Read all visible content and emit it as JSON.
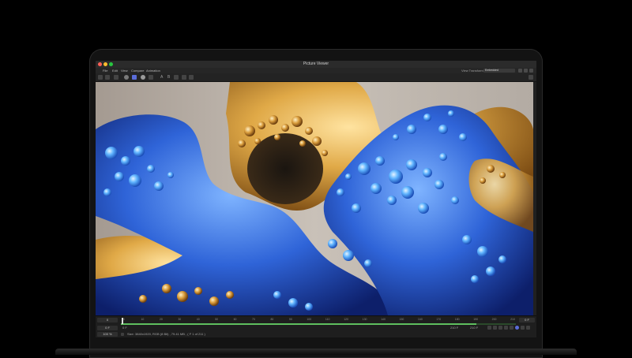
{
  "window": {
    "title": "Picture Viewer"
  },
  "menu": {
    "items": [
      "File",
      "Edit",
      "View",
      "Compare",
      "Animation"
    ],
    "view_transform_label": "View Transform:",
    "view_transform_value": "Embedded"
  },
  "toolbar": {
    "text_a": "A",
    "text_b": "B"
  },
  "timeline": {
    "current_frame": "0",
    "end_frame": "0 F",
    "ticks": [
      "0",
      "10",
      "20",
      "30",
      "40",
      "50",
      "60",
      "70",
      "80",
      "90",
      "100",
      "110",
      "120",
      "130",
      "140",
      "150",
      "160",
      "170",
      "180",
      "190",
      "200",
      "210"
    ],
    "progress": 0.9
  },
  "controls": {
    "left_value": "0 F",
    "start_value": "0 F",
    "range_start": "210 F",
    "range_end": "210 F"
  },
  "status": {
    "zoom": "100 %",
    "info": "Size: 3840x1920, RGB (8 Bit) , 79.41 MB ,  ( F 1 of 211 )"
  },
  "colors": {
    "accent": "#5a6cd8",
    "progress": "#5fbf5f",
    "gold": "#d9a23a",
    "blue": "#2e63d6"
  },
  "icons": {
    "view_toggle": "two-panel-icon",
    "render": "render-icon",
    "target": "target-icon",
    "channel": "channel-icon",
    "settings": "settings-icon"
  }
}
